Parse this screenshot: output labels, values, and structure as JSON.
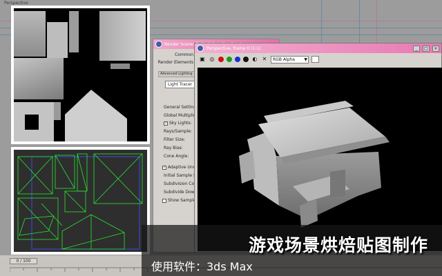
{
  "viewport": {
    "label": "Perspective"
  },
  "render_dialog": {
    "title": "Render Scene: Default Scanline Renderer",
    "tabs": [
      "Common",
      "Render Elements"
    ],
    "rollout_collapsed": "Advanced Lighting",
    "light_tracer_select": "Light Tracer",
    "settings_header": "General Settings:",
    "fields": [
      {
        "label": "Global Multiplier:",
        "checked": null
      },
      {
        "label": "Sky Lights:",
        "checked": true
      },
      {
        "label": "Rays/Sample:",
        "checked": null
      },
      {
        "label": "Filter Size:",
        "checked": null
      },
      {
        "label": "Ray Bias:",
        "checked": null
      },
      {
        "label": "Cone Angle:",
        "checked": null
      }
    ],
    "adaptive_label": "Adaptive Undersampling",
    "adaptive_checked": true,
    "adaptive_fields": [
      "Initial Sample Spacing:",
      "Subdivision Contrast:",
      "Subdivide Down To:"
    ],
    "show_samples_label": "Show Samples",
    "show_samples_checked": false
  },
  "frame_window": {
    "title": "Perspective, frame 0 (1:1)",
    "channel_value": "RGB Alpha",
    "channel_options": [
      "RGB Alpha"
    ],
    "channel_dots": [
      "#d01010",
      "#1a9a1a",
      "#1a2fd0",
      "#111111"
    ],
    "window_buttons": [
      "_",
      "□",
      "×"
    ]
  },
  "timeline": {
    "frame_counter": "0 / 100"
  },
  "caption": {
    "title": "游戏场景烘焙贴图制作",
    "subtitle": "使用软件：3ds Max"
  },
  "colors": {
    "caption_bg": "#161616",
    "title_bar_pink": "#e46fa9",
    "uv_green": "#29e62f",
    "uv_blue": "#3a4fe0"
  }
}
